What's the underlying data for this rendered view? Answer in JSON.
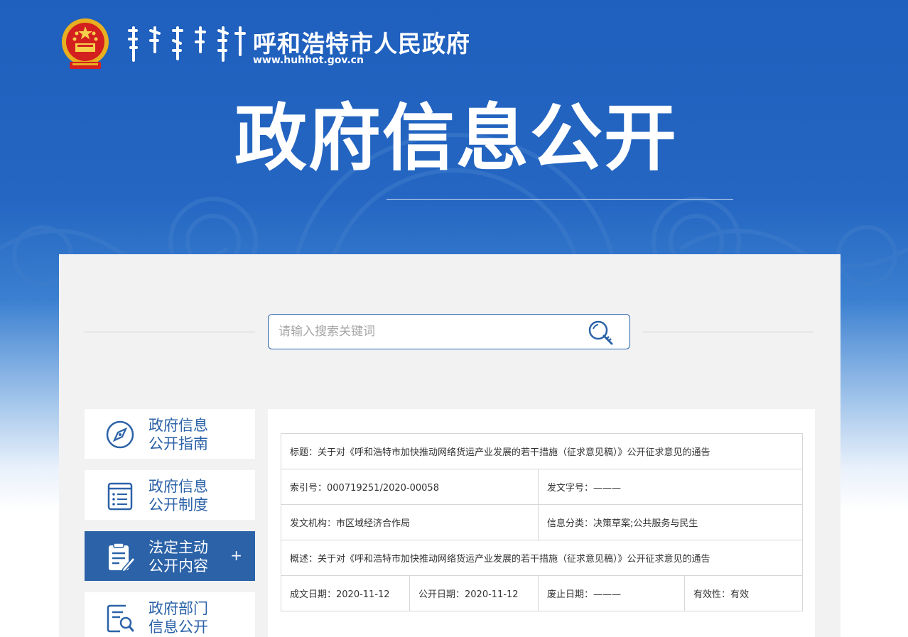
{
  "header": {
    "site_title": "呼和浩特市人民政府",
    "site_url": "www.huhhot.gov.cn"
  },
  "hero": {
    "title": "政府信息公开"
  },
  "search": {
    "placeholder": "请输入搜索关键词",
    "value": ""
  },
  "sidebar": {
    "items": [
      {
        "line1": "政府信息",
        "line2": "公开指南",
        "icon": "compass-icon",
        "active": false
      },
      {
        "line1": "政府信息",
        "line2": "公开制度",
        "icon": "document-list-icon",
        "active": false
      },
      {
        "line1": "法定主动",
        "line2": "公开内容",
        "icon": "clipboard-edit-icon",
        "active": true,
        "expand": "+"
      },
      {
        "line1": "政府部门",
        "line2": "信息公开",
        "icon": "document-search-icon",
        "active": false
      }
    ]
  },
  "document": {
    "title_label": "标题：",
    "title_value": "关于对《呼和浩特市加快推动网络货运产业发展的若干措施（征求意见稿）》公开征求意见的通告",
    "index_label": "索引号：",
    "index_value": "000719251/2020-00058",
    "doc_no_label": "发文字号：",
    "doc_no_value": "———",
    "issuer_label": "发文机构：",
    "issuer_value": "市区域经济合作局",
    "category_label": "信息分类：",
    "category_value": "决策草案;公共服务与民生",
    "summary_label": "概述：",
    "summary_value": "关于对《呼和浩特市加快推动网络货运产业发展的若干措施（征求意见稿）》公开征求意见的通告",
    "written_label": "成文日期：",
    "written_value": "2020-11-12",
    "published_label": "公开日期：",
    "published_value": "2020-11-12",
    "abolished_label": "废止日期：",
    "abolished_value": "———",
    "validity_label": "有效性：",
    "validity_value": "有效"
  },
  "colors": {
    "brand_blue": "#2b62a8",
    "header_blue": "#1f5fbd",
    "panel_bg": "#f2f2f2"
  }
}
